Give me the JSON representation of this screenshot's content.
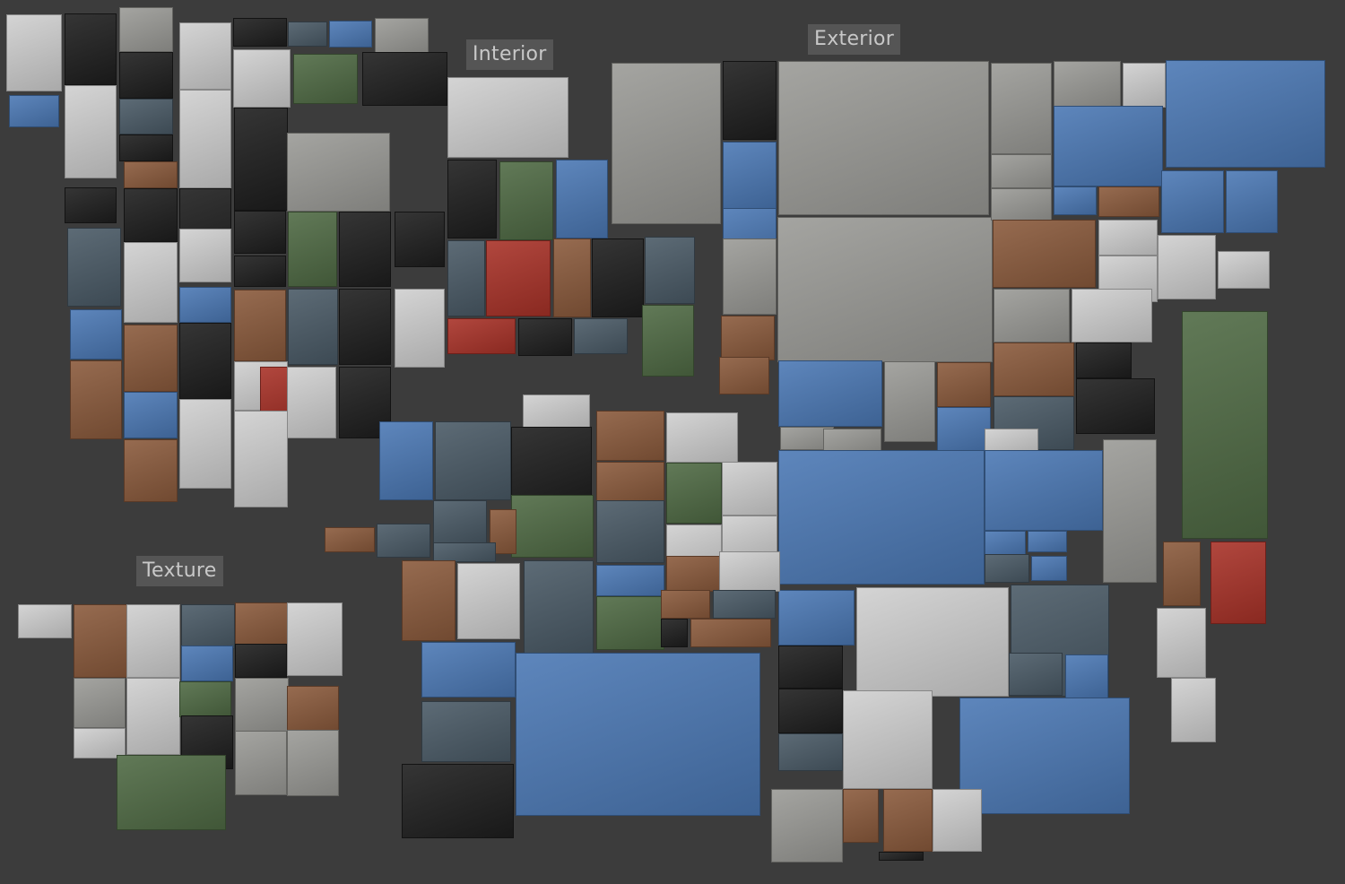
{
  "board": {
    "background": "#3c3c3c",
    "groups": [
      {
        "id": "interior",
        "label": "Interior"
      },
      {
        "id": "exterior",
        "label": "Exterior"
      },
      {
        "id": "texture",
        "label": "Texture"
      }
    ]
  },
  "palette": {
    "concrete": "#9a9a96",
    "dark": "#1e1e1e",
    "sky": "#4b78b4",
    "industrial": "#4a5a66",
    "warm": "#8a5a3c",
    "bw": "#cfcfcf",
    "green": "#4f6a44",
    "red": "#a83228"
  }
}
